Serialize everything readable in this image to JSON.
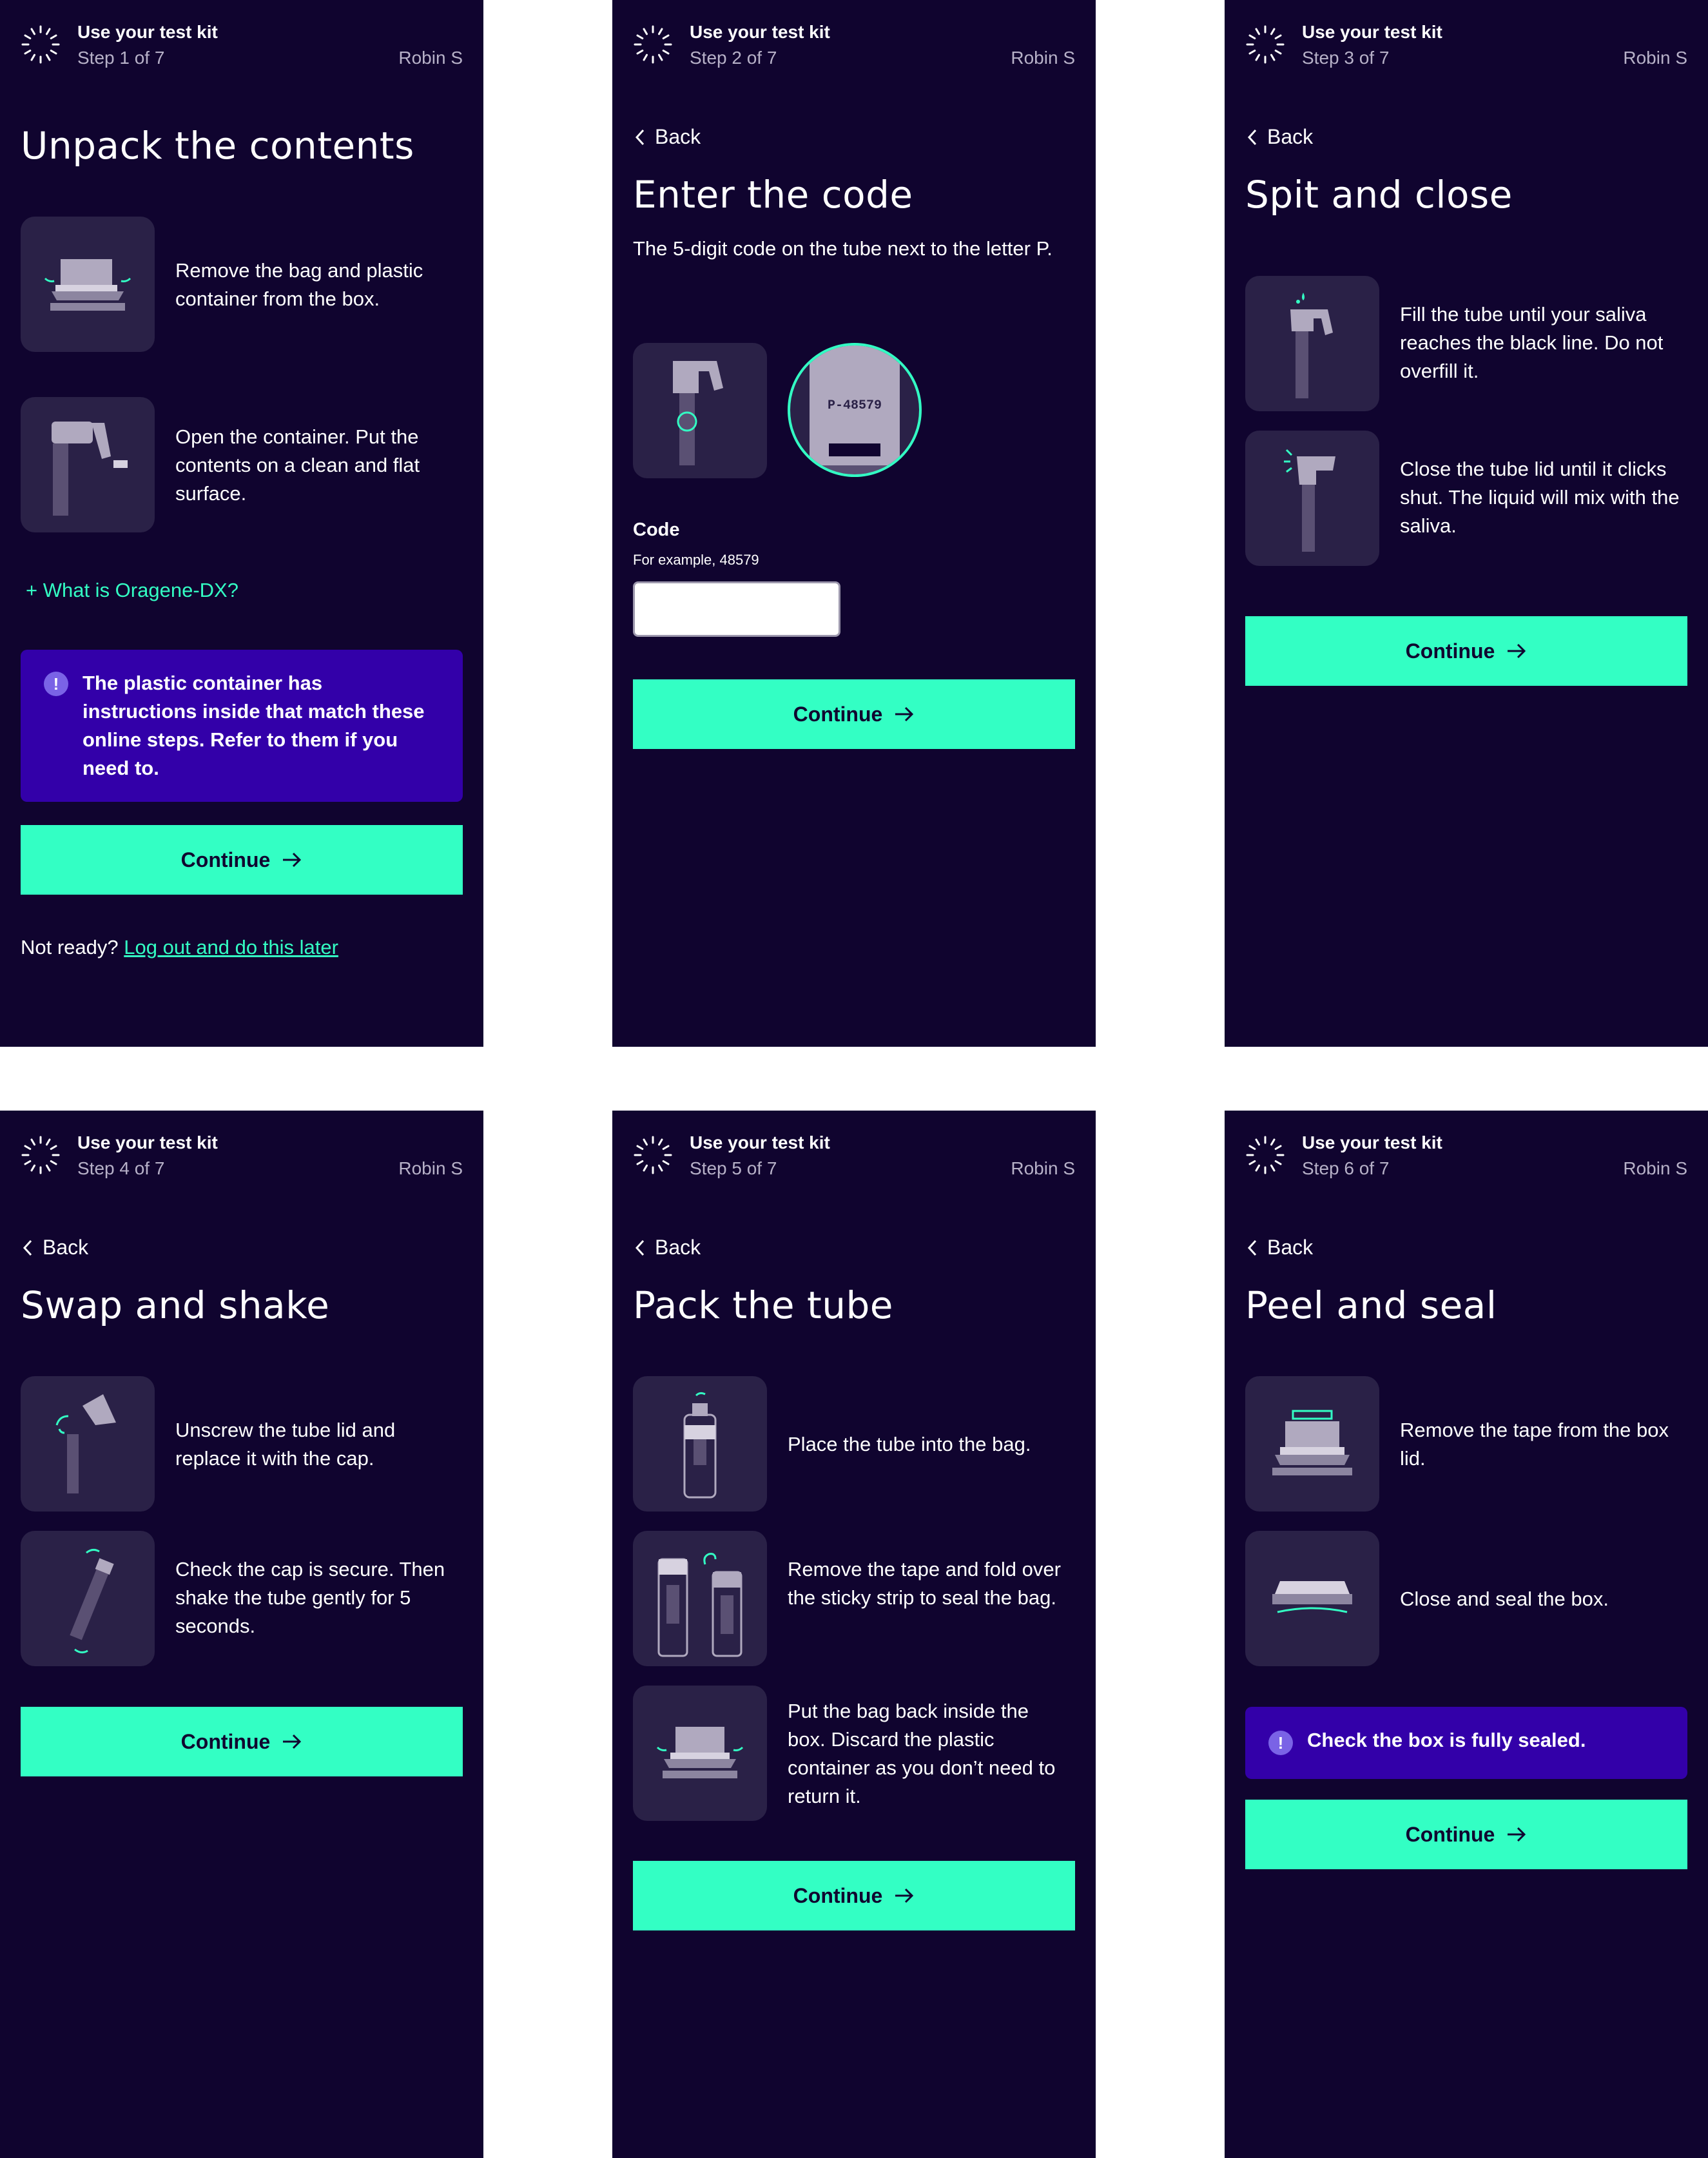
{
  "colors": {
    "background": "#10042f",
    "tile": "#2a2147",
    "accent": "#33ffc4",
    "callout": "#3300a9",
    "muted": "#b7b1c8"
  },
  "screens": [
    {
      "header": {
        "title": "Use your test kit",
        "step": "Step 1 of 7",
        "user": "Robin S"
      },
      "title": "Unpack the contents",
      "items": [
        {
          "icon": "box-open-icon",
          "text": "Remove the bag and plastic container from the box."
        },
        {
          "icon": "tube-open-icon",
          "text": "Open the container. Put the contents on a clean and flat surface."
        }
      ],
      "expand_link": "What is Oragene-DX?",
      "callout": "The plastic container has instructions inside that match these online steps. Refer to them if you need to.",
      "continue": "Continue",
      "not_ready": "Not ready?",
      "logout_link": "Log out and do this later"
    },
    {
      "header": {
        "title": "Use your test kit",
        "step": "Step 2 of 7",
        "user": "Robin S"
      },
      "back": "Back",
      "title": "Enter the code",
      "subtitle": "The 5-digit code on the tube next to the letter P.",
      "tube_code": "P-48579",
      "code_label": "Code",
      "code_hint": "For example, 48579",
      "code_value": "",
      "continue": "Continue"
    },
    {
      "header": {
        "title": "Use your test kit",
        "step": "Step 3 of 7",
        "user": "Robin S"
      },
      "back": "Back",
      "title": "Spit and close",
      "items": [
        {
          "icon": "tube-spit-icon",
          "text": "Fill the tube until your saliva reaches the black line. Do not overfill it."
        },
        {
          "icon": "tube-close-icon",
          "text": "Close the tube lid until it clicks shut. The liquid will mix with the saliva."
        }
      ],
      "continue": "Continue"
    },
    {
      "header": {
        "title": "Use your test kit",
        "step": "Step 4 of 7",
        "user": "Robin S"
      },
      "back": "Back",
      "title": "Swap and shake",
      "items": [
        {
          "icon": "tube-unscrew-icon",
          "text": "Unscrew the tube lid and replace it with the cap."
        },
        {
          "icon": "tube-shake-icon",
          "text": "Check the cap is secure. Then shake the tube gently for 5 seconds."
        }
      ],
      "continue": "Continue"
    },
    {
      "header": {
        "title": "Use your test kit",
        "step": "Step 5 of 7",
        "user": "Robin S"
      },
      "back": "Back",
      "title": "Pack the tube",
      "items": [
        {
          "icon": "tube-in-bag-icon",
          "text": "Place the tube into the bag."
        },
        {
          "icon": "bag-seal-icon",
          "text": "Remove the tape and fold over the sticky strip to seal the bag."
        },
        {
          "icon": "box-pack-icon",
          "text": "Put the bag back inside the box. Discard the plastic container as you don’t need to return it."
        }
      ],
      "continue": "Continue"
    },
    {
      "header": {
        "title": "Use your test kit",
        "step": "Step 6 of 7",
        "user": "Robin S"
      },
      "back": "Back",
      "title": "Peel and seal",
      "items": [
        {
          "icon": "box-tape-icon",
          "text": "Remove the tape from the box lid."
        },
        {
          "icon": "box-closed-icon",
          "text": "Close and seal the box."
        }
      ],
      "callout": "Check the box is fully sealed.",
      "continue": "Continue"
    }
  ]
}
